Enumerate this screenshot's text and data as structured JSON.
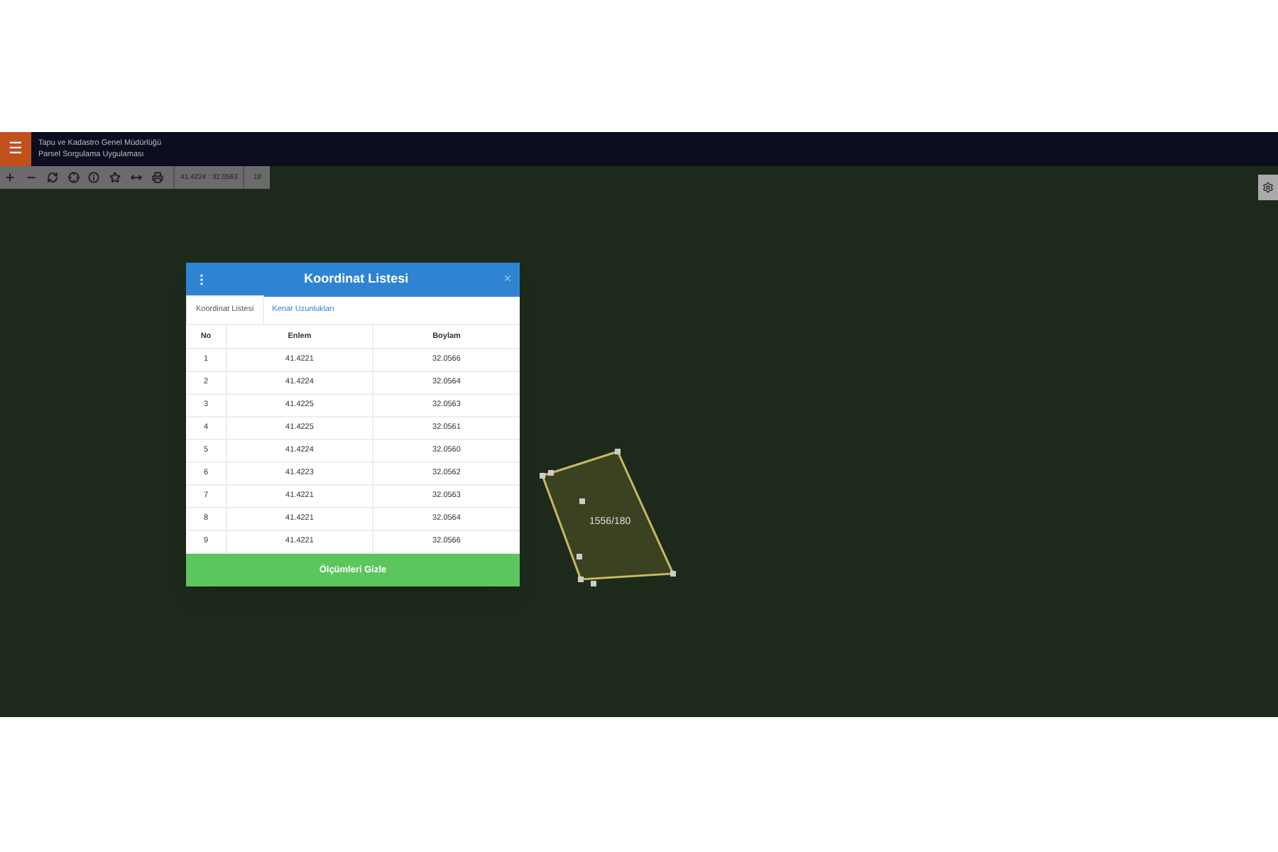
{
  "header": {
    "menu_icon": "☰",
    "title_line_1": "Tapu ve Kadastro Genel Müdürlüğü",
    "title_line_2": "Parsel Sorgulama Uygulaması"
  },
  "toolbar": {
    "coordinates": "41.4224 : 32.0563",
    "zoom": "18"
  },
  "parcel": {
    "label": "1556/180"
  },
  "dialog": {
    "title": "Koordinat Listesi",
    "close": "×",
    "tabs": [
      {
        "label": "Koordinat Listesi",
        "selected": true
      },
      {
        "label": "Kenar Uzunlukları",
        "selected": false
      }
    ],
    "columns": [
      "No",
      "Enlem",
      "Boylam"
    ],
    "rows": [
      {
        "no": "1",
        "lat": "41.4221",
        "lon": "32.0566"
      },
      {
        "no": "2",
        "lat": "41.4224",
        "lon": "32.0564"
      },
      {
        "no": "3",
        "lat": "41.4225",
        "lon": "32.0563"
      },
      {
        "no": "4",
        "lat": "41.4225",
        "lon": "32.0561"
      },
      {
        "no": "5",
        "lat": "41.4224",
        "lon": "32.0560"
      },
      {
        "no": "6",
        "lat": "41.4223",
        "lon": "32.0562"
      },
      {
        "no": "7",
        "lat": "41.4221",
        "lon": "32.0563"
      },
      {
        "no": "8",
        "lat": "41.4221",
        "lon": "32.0564"
      },
      {
        "no": "9",
        "lat": "41.4221",
        "lon": "32.0566"
      }
    ],
    "button": "Ölçümleri Gizle"
  }
}
